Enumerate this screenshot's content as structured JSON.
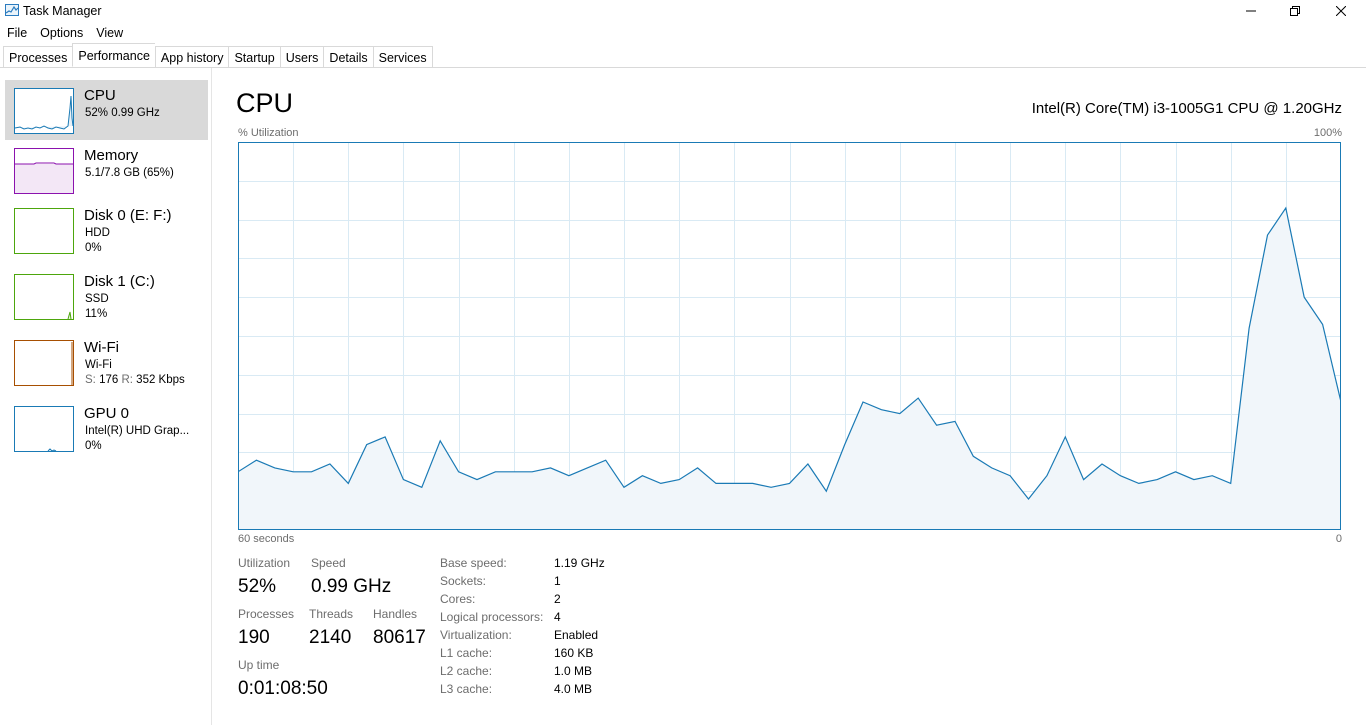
{
  "window": {
    "title": "Task Manager"
  },
  "menu": [
    "File",
    "Options",
    "View"
  ],
  "tabs": [
    "Processes",
    "Performance",
    "App history",
    "Startup",
    "Users",
    "Details",
    "Services"
  ],
  "sidebar": {
    "cpu": {
      "title": "CPU",
      "line1": "52% 0.99 GHz"
    },
    "memory": {
      "title": "Memory",
      "line1": "5.1/7.8 GB (65%)"
    },
    "disk0": {
      "title": "Disk 0 (E: F:)",
      "line1": "HDD",
      "line2": "0%"
    },
    "disk1": {
      "title": "Disk 1 (C:)",
      "line1": "SSD",
      "line2": "11%"
    },
    "wifi": {
      "title": "Wi-Fi",
      "line1": "Wi-Fi",
      "send_label": "S:",
      "send": "176",
      "recv_label": "R:",
      "recv": "352 Kbps"
    },
    "gpu": {
      "title": "GPU 0",
      "line1": "Intel(R) UHD Grap...",
      "line2": "0%"
    }
  },
  "main": {
    "title": "CPU",
    "model": "Intel(R) Core(TM) i3-1005G1 CPU @ 1.20GHz",
    "y_label": "% Utilization",
    "y_max": "100%",
    "x_label_left": "60 seconds",
    "x_label_right": "0"
  },
  "stats": {
    "utilization_label": "Utilization",
    "utilization": "52%",
    "speed_label": "Speed",
    "speed": "0.99 GHz",
    "processes_label": "Processes",
    "processes": "190",
    "threads_label": "Threads",
    "threads": "2140",
    "handles_label": "Handles",
    "handles": "80617",
    "uptime_label": "Up time",
    "uptime": "0:01:08:50"
  },
  "details": [
    {
      "key": "Base speed:",
      "value": "1.19 GHz"
    },
    {
      "key": "Sockets:",
      "value": "1"
    },
    {
      "key": "Cores:",
      "value": "2"
    },
    {
      "key": "Logical processors:",
      "value": "4"
    },
    {
      "key": "Virtualization:",
      "value": "Enabled"
    },
    {
      "key": "L1 cache:",
      "value": "160 KB"
    },
    {
      "key": "L2 cache:",
      "value": "1.0 MB"
    },
    {
      "key": "L3 cache:",
      "value": "4.0 MB"
    }
  ],
  "colors": {
    "cpu": "#1a7ab5",
    "memory": "#8b12ae",
    "disk": "#4da60c",
    "wifi": "#a74f01",
    "gpu": "#1a7ab5"
  },
  "chart_data": {
    "type": "area",
    "xlim": [
      60,
      0
    ],
    "ylim": [
      0,
      100
    ],
    "x": [
      60,
      59,
      58,
      57,
      56,
      55,
      54,
      53,
      52,
      51,
      50,
      49,
      48,
      47,
      46,
      45,
      44,
      43,
      42,
      41,
      40,
      39,
      38,
      37,
      36,
      35,
      34,
      33,
      32,
      31,
      30,
      29,
      28,
      27,
      26,
      25,
      24,
      23,
      22,
      21,
      20,
      19,
      18,
      17,
      16,
      15,
      14,
      13,
      12,
      11,
      10,
      9,
      8,
      7,
      6,
      5,
      4,
      3,
      2,
      1,
      0
    ],
    "values": [
      15,
      18,
      16,
      15,
      15,
      17,
      12,
      22,
      24,
      13,
      11,
      23,
      15,
      13,
      15,
      15,
      15,
      16,
      14,
      16,
      18,
      11,
      14,
      12,
      13,
      16,
      12,
      12,
      12,
      11,
      12,
      17,
      10,
      22,
      33,
      31,
      30,
      34,
      27,
      28,
      19,
      16,
      14,
      8,
      14,
      24,
      13,
      17,
      14,
      12,
      13,
      15,
      13,
      14,
      12,
      52,
      76,
      83,
      60,
      53,
      33
    ]
  }
}
